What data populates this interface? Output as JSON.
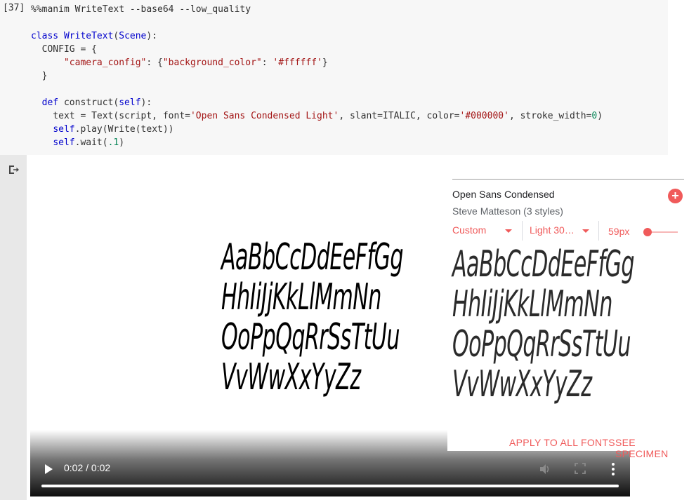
{
  "cell": {
    "prompt": "[37]",
    "lines": [
      "%%manim WriteText --base64 --low_quality",
      "",
      "class WriteText(Scene):",
      "  CONFIG = {",
      "      \"camera_config\": {\"background_color\": '#ffffff'}",
      "  }",
      "",
      "  def construct(self):",
      "    text = Text(script, font='Open Sans Condensed Light', slant=ITALIC, color='#000000', stroke_width=0)",
      "    self.play(Write(text))",
      "    self.wait(.1)"
    ]
  },
  "output": {
    "icon": "output-redirect-icon"
  },
  "video": {
    "specimen_lines": [
      "AaBbCcDdEeFfGg",
      "HhIiJjKkLlMmNn",
      "OoPpQqRrSsTtUu",
      "VvWwXxYyZz"
    ],
    "time": "0:02 / 0:02",
    "progress": 1.0,
    "icons": {
      "play": "play-icon",
      "volume": "volume-icon",
      "fullscreen": "fullscreen-icon",
      "more": "more-vert-icon"
    }
  },
  "font_panel": {
    "font_name": "Open Sans Condensed",
    "author": "Steve Matteson (3 styles)",
    "add_icon": "+",
    "select_custom": "Custom",
    "select_style": "Light 30…",
    "size": "59px",
    "size_slider_fraction": 0.0,
    "specimen_lines": [
      "AaBbCcDdEeFfGg",
      "HhIiJjKkLlMmNn",
      "OoPpQqRrSsTtUu",
      "VvWwXxYyZz"
    ],
    "apply_all": "APPLY TO ALL FONTS",
    "see_specimen": "SEE SPECIMEN",
    "accent_color": "#f05a5a"
  }
}
